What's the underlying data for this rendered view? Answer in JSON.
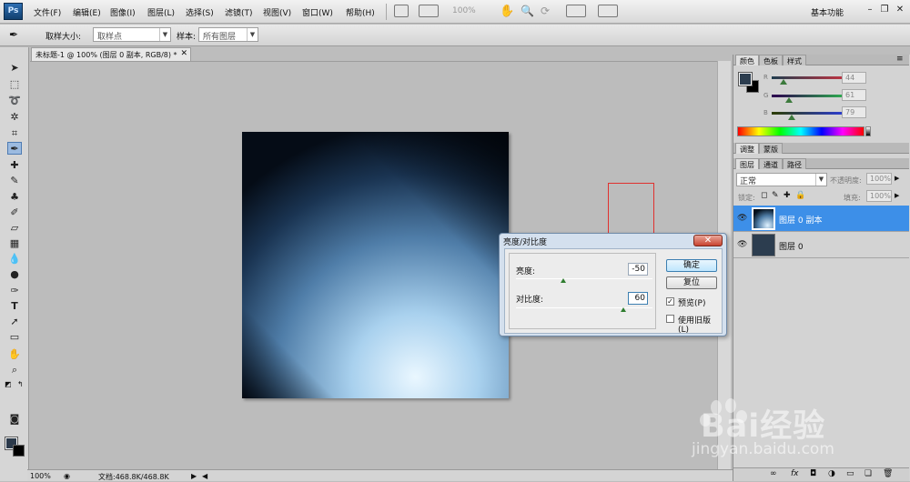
{
  "app": {
    "logo": "Ps"
  },
  "menu": {
    "items": [
      "文件(F)",
      "编辑(E)",
      "图像(I)",
      "图层(L)",
      "选择(S)",
      "滤镜(T)",
      "视图(V)",
      "窗口(W)",
      "帮助(H)"
    ],
    "zoom": "100%",
    "workspace": "基本功能"
  },
  "options": {
    "sample_size_label": "取样大小:",
    "sample_size_value": "取样点",
    "sample_label": "样本:",
    "sample_value": "所有图层"
  },
  "document": {
    "tab_title": "未标题-1 @ 100% (图层 0 副本, RGB/8) *",
    "status_zoom": "100%",
    "status_doc": "文档:468.8K/468.8K"
  },
  "color_panel": {
    "tabs": [
      "颜色",
      "色板",
      "样式"
    ],
    "r_label": "R",
    "r_value": "44",
    "g_label": "G",
    "g_value": "61",
    "b_label": "B",
    "b_value": "79",
    "fg_color": "#2c3d4f",
    "bg_color": "#000000"
  },
  "adjust_panel": {
    "tabs": [
      "调整",
      "蒙版"
    ]
  },
  "layers_panel": {
    "tabs": [
      "图层",
      "通道",
      "路径"
    ],
    "blend_mode": "正常",
    "opacity_label": "不透明度:",
    "opacity_value": "100%",
    "lock_label": "锁定:",
    "fill_label": "填充:",
    "fill_value": "100%",
    "layers": [
      {
        "name": "图层 0 副本",
        "selected": true
      },
      {
        "name": "图层 0",
        "selected": false
      }
    ]
  },
  "dialog": {
    "title": "亮度/对比度",
    "close_symbol": "✕",
    "brightness_label": "亮度:",
    "brightness_value": "-50",
    "contrast_label": "对比度:",
    "contrast_value": "60",
    "ok_label": "确定",
    "reset_label": "复位",
    "preview_label": "预览(P)",
    "preview_checked": true,
    "legacy_label": "使用旧版(L)",
    "legacy_checked": false
  },
  "watermark": {
    "brand": "Bai经验",
    "url": "jingyan.baidu.com"
  }
}
